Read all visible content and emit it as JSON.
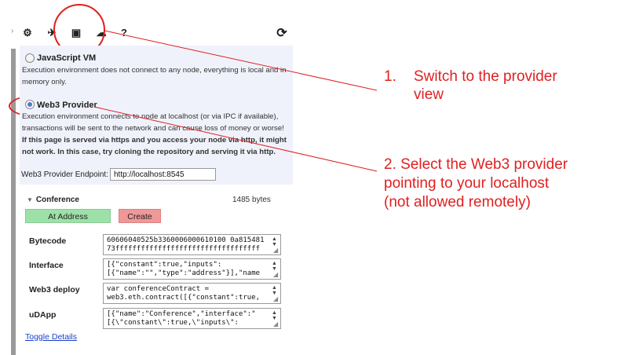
{
  "toolbar": {
    "items": [
      {
        "name": "settings",
        "glyph": "⚙"
      },
      {
        "name": "send",
        "glyph": "✈"
      },
      {
        "name": "box",
        "glyph": "▣"
      },
      {
        "name": "cloud",
        "glyph": "☁"
      },
      {
        "name": "help",
        "glyph": "?"
      }
    ],
    "right_glyph": "⟳",
    "left_glyph": "›"
  },
  "environment": {
    "javascript_vm": {
      "label": "JavaScript VM",
      "description": "Execution environment does not connect to any node, everything is local and in memory only."
    },
    "web3_provider": {
      "label": "Web3 Provider",
      "description": "Execution environment connects to node at localhost (or via IPC if available), transactions will be sent to the network and can cause loss of money or worse!",
      "warning": "If this page is served via https and you access your node via http, it might not work. In this case, try cloning the repository and serving it via http."
    },
    "endpoint_label": "Web3 Provider Endpoint:",
    "endpoint_value": "http://localhost:8545"
  },
  "contract": {
    "title": "Conference",
    "caret": "▼",
    "size": "1485 bytes",
    "at_address_label": "At Address",
    "create_label": "Create",
    "rows": [
      {
        "label": "Bytecode",
        "line1": "60606040525b3360006000610100 0a815481",
        "line2": "73ffffffffffffffffffffffffffffffffff"
      },
      {
        "label": "Interface",
        "line1": "[{\"constant\":true,\"inputs\":",
        "line2": "[{\"name\":\"\",\"type\":\"address\"}],\"name"
      },
      {
        "label": "Web3 deploy",
        "line1": "var conferenceContract =",
        "line2": "web3.eth.contract([{\"constant\":true,"
      },
      {
        "label": "uDApp",
        "line1": "[{\"name\":\"Conference\",\"interface\":\"",
        "line2": "[{\\\"constant\\\":true,\\\"inputs\\\":"
      }
    ],
    "toggle_details": "Toggle Details"
  },
  "annotations": {
    "step1_number": "1.",
    "step1_line1": "Switch to the provider",
    "step1_line2": "view",
    "step2_line1": "2. Select the Web3 provider",
    "step2_line2": "pointing to your localhost",
    "step2_line3": "(not allowed remotely)"
  },
  "colors": {
    "annotation": "#e02020",
    "panel": "#f0f2fb",
    "at_address": "#9de0a8",
    "create": "#f09898",
    "link": "#1a3fcf"
  }
}
